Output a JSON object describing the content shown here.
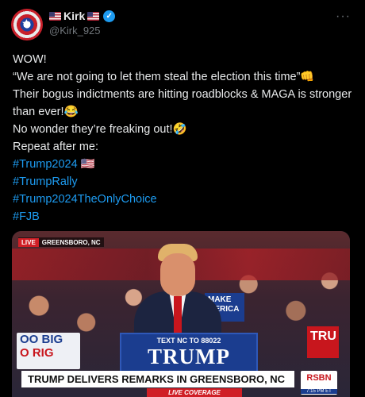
{
  "author": {
    "display_name": "Kirk",
    "handle": "@Kirk_925",
    "verified": true
  },
  "menu": {
    "more_label": "···"
  },
  "post": {
    "lines": [
      "WOW!",
      "“We are not going to let them steal the election this time”👊",
      "Their bogus indictments are hitting roadblocks & MAGA is stronger than ever!😂",
      "No wonder they’re freaking out!🤣",
      "Repeat after me:"
    ],
    "hashtags": [
      "#Trump2024 🇺🇸",
      "#TrumpRally",
      "#Trump2024TheOnlyChoice",
      "#FJB"
    ]
  },
  "media": {
    "live_badge": "LIVE",
    "location": "GREENSBORO, NC",
    "podium_sub": "TEXT NC TO 88022",
    "podium_title": "TRUMP",
    "sign_left_line1": "OO BIG",
    "sign_left_line2": "O RIG",
    "sign_make": "MAKE MERICA",
    "sign_right": "TRU",
    "headline": "TRUMP DELIVERS REMARKS IN GREENSBORO, NC",
    "subline": "LIVE COVERAGE",
    "network_logo": "RSBN",
    "network_time": "7:15 PM ET"
  },
  "colors": {
    "link": "#1d9bf0",
    "background": "#000000",
    "text": "#e7e9ea",
    "muted": "#71767b"
  }
}
